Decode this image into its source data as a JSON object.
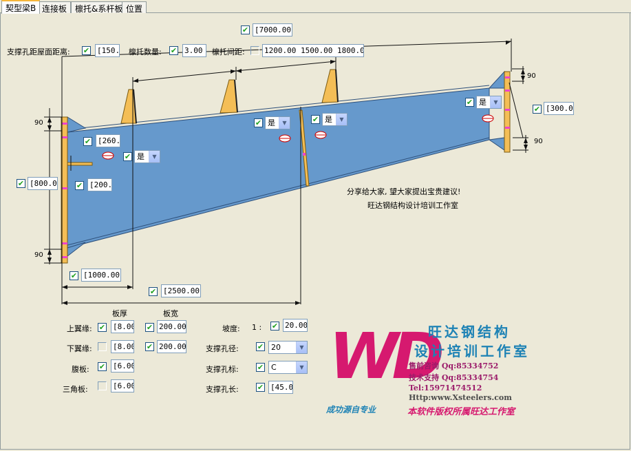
{
  "tabs": [
    {
      "label": "契型梁B",
      "active": true
    },
    {
      "label": "连接板",
      "active": false
    },
    {
      "label": "檩托&系杆板",
      "active": false
    },
    {
      "label": "位置",
      "active": false
    }
  ],
  "top": {
    "total_length": "[7000.00]",
    "support_hole_label": "支撑孔距屋面距离:",
    "support_hole_value": "[150.0",
    "purlin_count_label": "檩托数量:",
    "purlin_count_value": "3.00",
    "purlin_spacing_label": "檩托间距:",
    "purlin_spacing_value": "1200.00 1500.00 1800.00"
  },
  "diagram": {
    "left_height": "[800.00]",
    "right_height": "[300.00]",
    "left_offset": "[260.0",
    "stiffener_pos": "[200.0",
    "bottom_1000": "[1000.00]",
    "bottom_2500": "[2500.00]",
    "dim_90": "90",
    "yes": "是",
    "note_line1": "分享给大家, 望大家提出宝贵建议!",
    "note_line2": "旺达钢结构设计培训工作室"
  },
  "bottom": {
    "thickness_header": "板厚",
    "width_header": "板宽",
    "top_flange_label": "上翼缘:",
    "top_flange_thk": "[8.00",
    "top_flange_width": "200.00",
    "bottom_flange_label": "下翼缘:",
    "bottom_flange_thk": "[8.00",
    "bottom_flange_width": "200.00",
    "web_label": "腹板:",
    "web_thk": "[6.00",
    "triangle_label": "三角板:",
    "triangle_thk": "[6.00",
    "slope_label": "坡度:",
    "slope_prefix": "1 :",
    "slope_value": "20.00",
    "hole_dia_label": "支撑孔径:",
    "hole_dia_value": "20",
    "hole_mark_label": "支撑孔标:",
    "hole_mark_value": "C",
    "hole_len_label": "支撑孔长:",
    "hole_len_value": "[45.0"
  },
  "logo": {
    "letters": "WD",
    "title1": "旺达钢结构",
    "title2": "设计培训工作室",
    "line1": "售前咨询 Qq:85334752",
    "line2": "技术支持 Qq:85334754",
    "line3": "Tel:15971474512",
    "line4": "Http:www.Xsteelers.com",
    "slogan": "成功源自专业",
    "copyright": "本软件版权所属旺达工作室"
  },
  "colors": {
    "beam_blue": "#6699cc",
    "plate_orange": "#f4be56",
    "bolt_magenta": "#ee44cc",
    "logo_pink": "#d6196f",
    "logo_blue": "#1d82b5"
  }
}
